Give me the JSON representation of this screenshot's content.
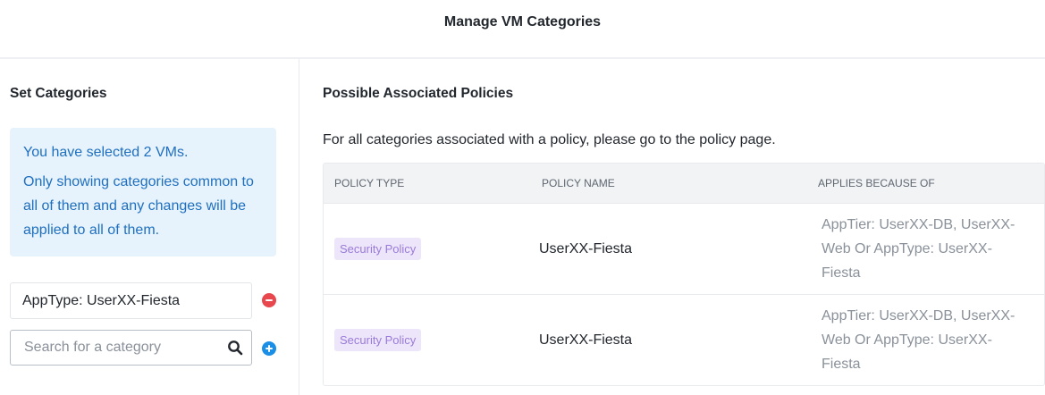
{
  "header": {
    "title": "Manage VM Categories"
  },
  "left": {
    "title": "Set Categories",
    "info_line1": "You have selected 2 VMs.",
    "info_line2": "Only showing categories common to all of them and any changes will be applied to all of them.",
    "category_value": "AppType: UserXX-Fiesta",
    "search_placeholder": "Search for a category"
  },
  "right": {
    "title": "Possible Associated Policies",
    "description": "For all categories associated with a policy, please go to the policy page.",
    "columns": [
      "POLICY TYPE",
      "POLICY NAME",
      "APPLIES BECAUSE OF"
    ],
    "rows": [
      {
        "type": "Security Policy",
        "name": "UserXX-Fiesta",
        "reason": "AppTier: UserXX-DB, UserXX-Web Or AppType: UserXX-Fiesta"
      },
      {
        "type": "Security Policy",
        "name": "UserXX-Fiesta",
        "reason": "AppTier: UserXX-DB, UserXX-Web Or AppType: UserXX-Fiesta"
      }
    ]
  },
  "colors": {
    "info_bg": "#e6f3fc",
    "info_text": "#1f6fbf",
    "remove": "#e8474e",
    "add": "#1b8ee6",
    "badge_bg": "#ede6fb",
    "badge_text": "#9a7ad8"
  },
  "icons": [
    "remove-icon",
    "search-icon",
    "add-icon"
  ]
}
